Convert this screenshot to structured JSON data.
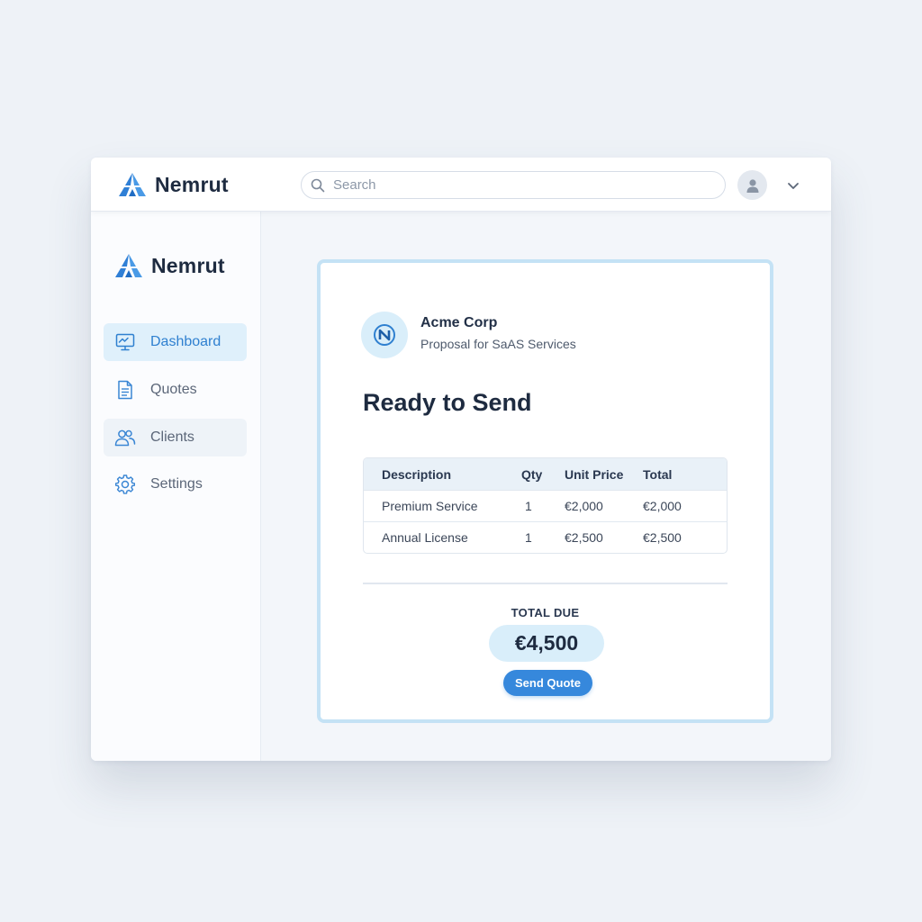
{
  "app": {
    "name": "Nemrut"
  },
  "search": {
    "placeholder": "Search"
  },
  "sidebar": {
    "items": [
      {
        "label": "Dashboard",
        "icon": "dashboard-icon",
        "active": true
      },
      {
        "label": "Quotes",
        "icon": "document-icon",
        "active": false
      },
      {
        "label": "Clients",
        "icon": "users-icon",
        "active": false
      },
      {
        "label": "Settings",
        "icon": "gear-icon",
        "active": false
      }
    ]
  },
  "quote": {
    "client_name": "Acme Corp",
    "subtitle": "Proposal for SaAS Services",
    "client_logo_letter": "N",
    "status_title": "Ready to Send",
    "table": {
      "headers": {
        "description": "Description",
        "qty": "Qty",
        "unit_price": "Unit Price",
        "total": "Total"
      },
      "rows": [
        {
          "description": "Premium Service",
          "qty": "1",
          "unit_price": "€2,000",
          "total": "€2,000"
        },
        {
          "description": "Annual License",
          "qty": "1",
          "unit_price": "€2,500",
          "total": "€2,500"
        }
      ]
    },
    "total_label": "TOTAL DUE",
    "total_value": "€4,500",
    "send_label": "Send Quote"
  },
  "colors": {
    "accent": "#3688dc",
    "accent_light": "#dff0fb",
    "card_border": "#c4e2f5"
  }
}
